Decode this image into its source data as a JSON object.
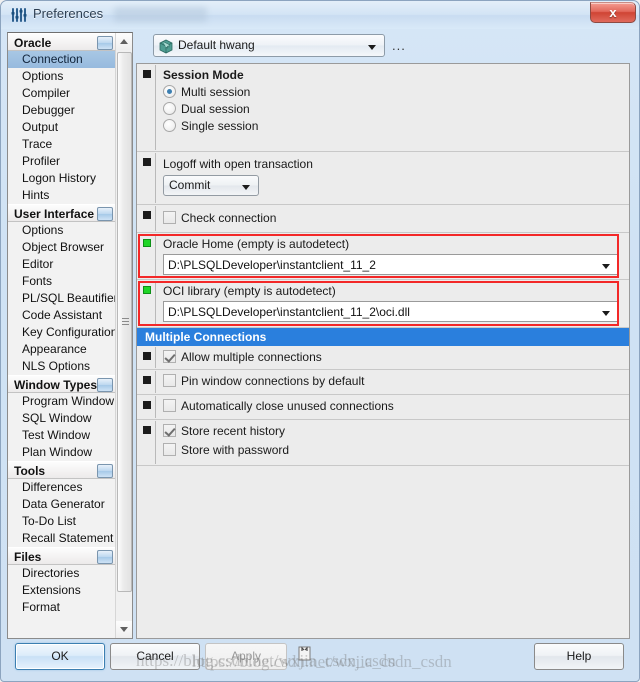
{
  "window": {
    "title": "Preferences",
    "title_icon": "sliders-icon",
    "close_label": "x"
  },
  "toolbar": {
    "connection_icon": "package-icon",
    "connection_value": "Default hwang",
    "ellipsis_label": "..."
  },
  "sidebar": {
    "groups": [
      {
        "label": "Oracle",
        "items": [
          {
            "label": "Connection",
            "selected": true
          },
          {
            "label": "Options",
            "selected": false
          },
          {
            "label": "Compiler",
            "selected": false
          },
          {
            "label": "Debugger",
            "selected": false
          },
          {
            "label": "Output",
            "selected": false
          },
          {
            "label": "Trace",
            "selected": false
          },
          {
            "label": "Profiler",
            "selected": false
          },
          {
            "label": "Logon History",
            "selected": false
          },
          {
            "label": "Hints",
            "selected": false
          }
        ]
      },
      {
        "label": "User Interface",
        "items": [
          {
            "label": "Options",
            "selected": false
          },
          {
            "label": "Object Browser",
            "selected": false
          },
          {
            "label": "Editor",
            "selected": false
          },
          {
            "label": "Fonts",
            "selected": false
          },
          {
            "label": "PL/SQL Beautifier",
            "selected": false
          },
          {
            "label": "Code Assistant",
            "selected": false
          },
          {
            "label": "Key Configuration",
            "selected": false
          },
          {
            "label": "Appearance",
            "selected": false
          },
          {
            "label": "NLS Options",
            "selected": false
          }
        ]
      },
      {
        "label": "Window Types",
        "items": [
          {
            "label": "Program Window",
            "selected": false
          },
          {
            "label": "SQL Window",
            "selected": false
          },
          {
            "label": "Test Window",
            "selected": false
          },
          {
            "label": "Plan Window",
            "selected": false
          }
        ]
      },
      {
        "label": "Tools",
        "items": [
          {
            "label": "Differences",
            "selected": false
          },
          {
            "label": "Data Generator",
            "selected": false
          },
          {
            "label": "To-Do List",
            "selected": false
          },
          {
            "label": "Recall Statement",
            "selected": false
          }
        ]
      },
      {
        "label": "Files",
        "items": [
          {
            "label": "Directories",
            "selected": false
          },
          {
            "label": "Extensions",
            "selected": false
          },
          {
            "label": "Format",
            "selected": false
          }
        ]
      }
    ]
  },
  "main": {
    "session_mode": {
      "heading": "Session Mode",
      "options": [
        {
          "label": "Multi session",
          "selected": true
        },
        {
          "label": "Dual session",
          "selected": false
        },
        {
          "label": "Single session",
          "selected": false
        }
      ]
    },
    "logoff": {
      "label": "Logoff with open transaction",
      "value": "Commit"
    },
    "check_connection": {
      "label": "Check connection",
      "checked": false
    },
    "oracle_home": {
      "label": "Oracle Home (empty is autodetect)",
      "value": "D:\\PLSQLDeveloper\\instantclient_11_2",
      "highlighted": true
    },
    "oci_library": {
      "label": "OCI library (empty is autodetect)",
      "value": "D:\\PLSQLDeveloper\\instantclient_11_2\\oci.dll",
      "highlighted": true
    },
    "multiple_connections": {
      "heading": "Multiple Connections",
      "items": [
        {
          "label": "Allow multiple connections",
          "checked": true
        },
        {
          "label": "Pin window connections by default",
          "checked": false
        },
        {
          "label": "Automatically close unused connections",
          "checked": false
        },
        {
          "label": "Store recent history",
          "checked": true
        },
        {
          "label": "Store with password",
          "checked": false
        }
      ]
    }
  },
  "footer": {
    "ok": "OK",
    "cancel": "Cancel",
    "apply": "Apply",
    "help": "Help",
    "paste_icon": "paste-icon"
  },
  "watermark": {
    "line1": "https://blog.csdn.net/wxjia_csdn_csdn",
    "line2": "https://blog.csdn.net/wxjia_csdn_csdn"
  },
  "colors": {
    "accent": "#2a7fdd",
    "highlight": "#f32828",
    "marker_green": "#1fd627",
    "selection": "#a8c7e4"
  }
}
